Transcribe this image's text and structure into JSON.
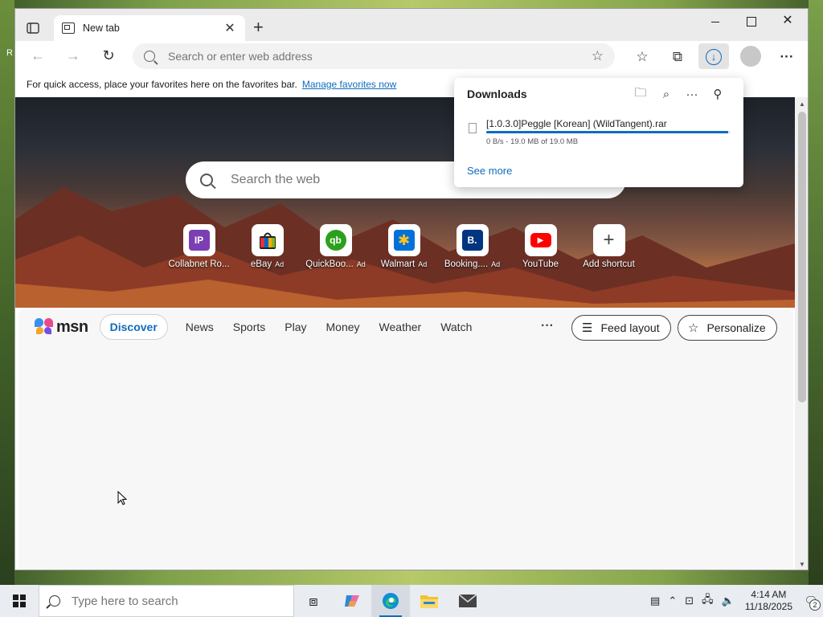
{
  "browser": {
    "tab": {
      "title": "New tab"
    },
    "address": {
      "placeholder": "Search or enter web address"
    },
    "favbar": {
      "text": "For quick access, place your favorites here on the favorites bar.",
      "link": "Manage favorites now"
    }
  },
  "downloads": {
    "title": "Downloads",
    "item": {
      "filename": "[1.0.3.0]Peggle [Korean] (WildTangent).rar",
      "status": "0 B/s - 19.0 MB of 19.0 MB",
      "progress_percent": 99
    },
    "see_more": "See more"
  },
  "newtab": {
    "search_placeholder": "Search the web",
    "shortcuts": [
      {
        "label": "Collabnet Ro...",
        "ad": "",
        "icon": "IP",
        "color": "#7b3fb3"
      },
      {
        "label": "eBay",
        "ad": "Ad",
        "icon": "bag",
        "color": "#e53238"
      },
      {
        "label": "QuickBoo...",
        "ad": "Ad",
        "icon": "qb",
        "color": "#2ca01c"
      },
      {
        "label": "Walmart",
        "ad": "Ad",
        "icon": "✱",
        "color": "#0071dc"
      },
      {
        "label": "Booking....",
        "ad": "Ad",
        "icon": "B.",
        "color": "#003580"
      },
      {
        "label": "YouTube",
        "ad": "",
        "icon": "▶",
        "color": "#ff0000"
      },
      {
        "label": "Add shortcut",
        "ad": "",
        "icon": "+",
        "color": "#444444"
      }
    ]
  },
  "feed": {
    "logo": "msn",
    "tabs": [
      "Discover",
      "News",
      "Sports",
      "Play",
      "Money",
      "Weather",
      "Watch"
    ],
    "more": "···",
    "feed_layout": "Feed layout",
    "personalize": "Personalize"
  },
  "taskbar": {
    "search_placeholder": "Type here to search",
    "time": "4:14 AM",
    "date": "11/18/2025",
    "notification_count": "2"
  },
  "colors": {
    "accent": "#0f6cbd",
    "titlebar": "#ebebeb"
  },
  "icons": [
    "window-icon",
    "newtab-icon",
    "back-icon",
    "forward-icon",
    "reload-icon",
    "search-icon",
    "add-favorite-icon",
    "favorites-icon",
    "collections-icon",
    "download-icon",
    "profile-icon",
    "more-icon",
    "folder-icon",
    "pin-icon",
    "file-icon",
    "windows-icon",
    "task-view-icon",
    "copilot-icon",
    "edge-icon",
    "file-explorer-icon",
    "mail-icon"
  ]
}
